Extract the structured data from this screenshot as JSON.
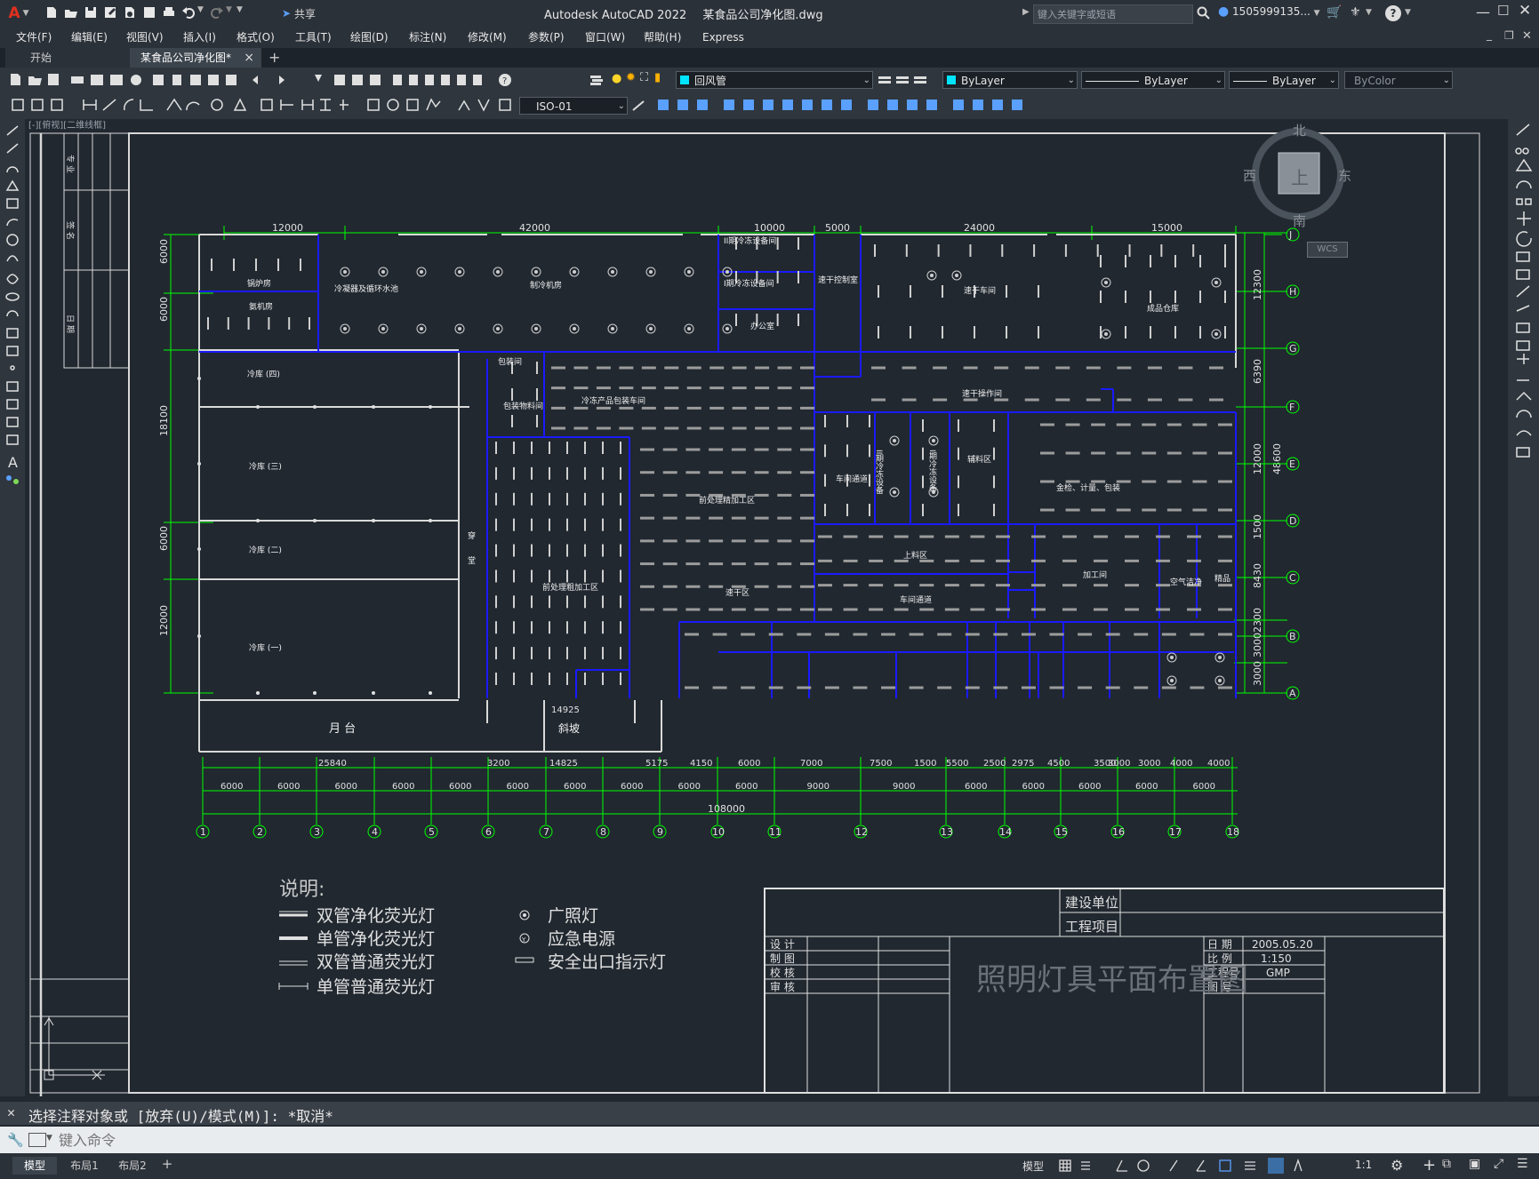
{
  "title_bar": {
    "app_title": "Autodesk AutoCAD 2022",
    "file_name": "某食品公司净化图.dwg",
    "share_label": "共享",
    "search_placeholder": "键入关键字或短语",
    "user": "1505999135...",
    "help": "?"
  },
  "menu": [
    "文件(F)",
    "编辑(E)",
    "视图(V)",
    "插入(I)",
    "格式(O)",
    "工具(T)",
    "绘图(D)",
    "标注(N)",
    "修改(M)",
    "参数(P)",
    "窗口(W)",
    "帮助(H)",
    "Express"
  ],
  "doc_tabs": {
    "start": "开始",
    "active": "某食品公司净化图*",
    "close": "×",
    "add": "+"
  },
  "toolbar": {
    "layer": "回风管",
    "color": "ByLayer",
    "linetype": "ByLayer",
    "lineweight": "ByLayer",
    "plotstyle": "ByColor",
    "dimstyle": "ISO-01"
  },
  "viewcube": {
    "north": "北",
    "south": "南",
    "east": "东",
    "west": "西",
    "top": "上",
    "wcs": "WCS"
  },
  "drawing": {
    "top_dims": [
      "12000",
      "42000",
      "10000",
      "5000",
      "24000",
      "15000"
    ],
    "left_dims": [
      "6000",
      "6000",
      "18100",
      "6000",
      "12000"
    ],
    "right_dims": [
      "12300",
      "6390",
      "12000",
      "1500",
      "8430",
      "2300",
      "3000",
      "3000"
    ],
    "right_total": "48600",
    "row_axes": [
      "J",
      "H",
      "G",
      "F",
      "E",
      "D",
      "C",
      "B",
      "A"
    ],
    "col_axes": [
      "1",
      "2",
      "3",
      "4",
      "5",
      "6",
      "7",
      "8",
      "9",
      "10",
      "11",
      "12",
      "13",
      "14",
      "15",
      "16",
      "17",
      "18"
    ],
    "bottom_row1": [
      "25840",
      "3200",
      "14825",
      "5175",
      "4150",
      "6000",
      "7000",
      "7500",
      "1500",
      "5500",
      "2500",
      "2975",
      "4500",
      "3500",
      "3000",
      "3000",
      "4000",
      "4000"
    ],
    "bottom_row2": [
      "6000",
      "6000",
      "6000",
      "6000",
      "6000",
      "6000",
      "6000",
      "6000",
      "6000",
      "6000",
      "9000",
      "9000",
      "6000",
      "6000",
      "6000",
      "6000",
      "6000"
    ],
    "bottom_total": "108000",
    "dim_14925": "14925",
    "rooms": [
      "锅炉房",
      "氨机房",
      "冷凝器及循环水池",
      "制冷机房",
      "冷库 (四)",
      "冷库 (三)",
      "冷库 (二)",
      "冷库 (一)",
      "穿",
      "堂",
      "月 台",
      "斜坡",
      "II期冷冻设备间",
      "I期冷冻设备间",
      "办公室",
      "速干控制室",
      "速干车间",
      "成品仓库",
      "包装间",
      "冷冻产品包装车间",
      "速干操作间",
      "包装物料间",
      "前处理粗加工区",
      "前处理精加工区",
      "速干区",
      "车间通道",
      "II期冷冻设备",
      "I期冷冻设备",
      "辅料区",
      "金检、计量、包装",
      "上料区",
      "车间通道",
      "加工间",
      "空气洁净",
      "精品"
    ]
  },
  "legend": {
    "title": "说明:",
    "items": [
      "双管净化荧光灯",
      "单管净化荧光灯",
      "双管普通荧光灯",
      "单管普通荧光灯"
    ],
    "items_right": [
      "广照灯",
      "应急电源",
      "安全出口指示灯"
    ]
  },
  "title_block": {
    "client_label": "建设单位",
    "project_label": "工程项目",
    "sign_rows": [
      "设 计",
      "制 图",
      "校 核",
      "审 核"
    ],
    "drawing_title": "照明灯具平面布置图",
    "date_label": "日 期",
    "date": "2005.05.20",
    "scale_label": "比 例",
    "scale": "1:150",
    "project_no_label": "工程号",
    "project_no": "GMP",
    "drawing_no_label": "图 号"
  },
  "left_strip": [
    "专 业",
    "签 名",
    "日 期"
  ],
  "command": {
    "history": "选择注释对象或 [放弃(U)/模式(M)]: *取消*",
    "prompt_placeholder": "键入命令"
  },
  "layout_tabs": [
    "模型",
    "布局1",
    "布局2",
    "+"
  ],
  "status": {
    "model": "模型",
    "scale": "1:1"
  },
  "colors": {
    "dim_green": "#00ff00",
    "wall_blue": "#1a1aff",
    "lines_white": "#d9d9d9",
    "background": "#212830"
  }
}
